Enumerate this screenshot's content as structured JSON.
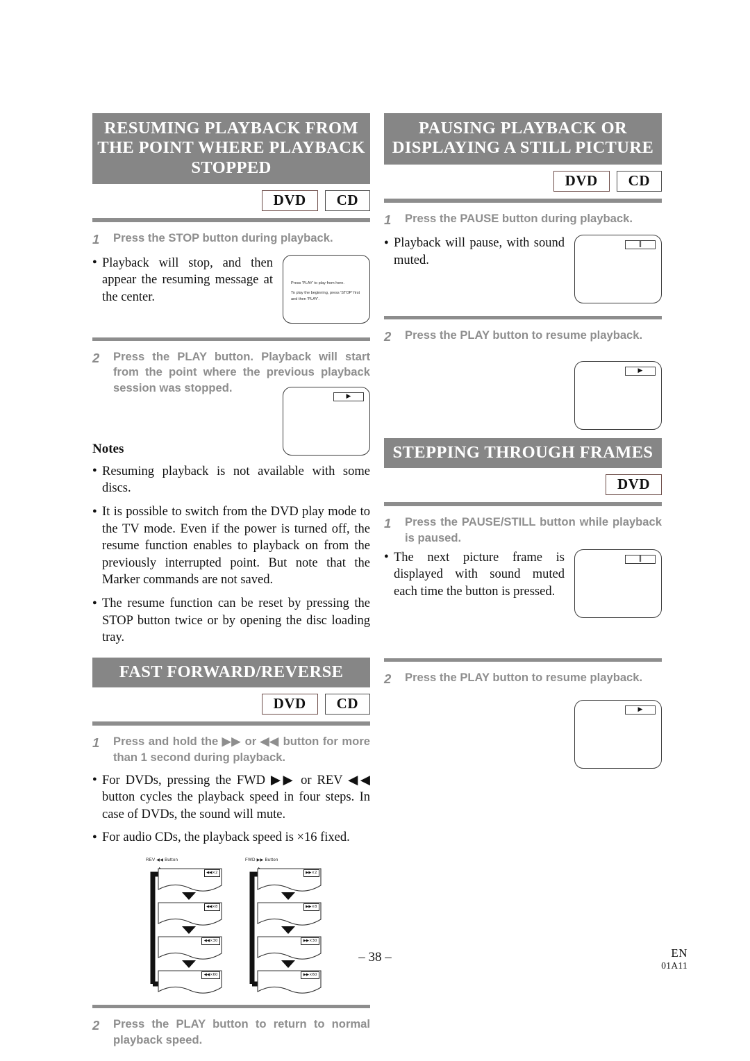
{
  "document": {
    "page_number": "– 38 –",
    "language_code": "EN",
    "doc_code": "01A11"
  },
  "left_column": {
    "section1": {
      "heading": "RESUMING PLAYBACK FROM THE POINT WHERE PLAYBACK STOPPED",
      "badges": [
        "DVD",
        "CD"
      ],
      "step1": {
        "number": "1",
        "text": "Press the STOP button during playback."
      },
      "step1_bullet": "Playback will stop, and then appear the resuming message at the center.",
      "screen1": {
        "msg_line1": "Press 'PLAY' to play from here.",
        "msg_line2": "To play the beginning, press 'STOP' first and then 'PLAY'."
      },
      "step2": {
        "number": "2",
        "text": "Press the PLAY button. Playback will start from the point where the previous playback session was stopped."
      },
      "screen2": {
        "osd": "▶"
      },
      "notes_title": "Notes",
      "notes": [
        "Resuming playback is not available with some discs.",
        "It is possible to switch from the DVD play mode to the TV mode. Even if the power is turned off, the resume function enables to playback on from the previously interrupted point. But note that the Marker commands are not saved.",
        "The resume function can be reset by pressing the STOP button twice or by opening the disc loading tray."
      ]
    },
    "section2": {
      "heading": "FAST FORWARD/REVERSE",
      "badges": [
        "DVD",
        "CD"
      ],
      "step1": {
        "number": "1",
        "text": "Press and hold the ▶▶ or ◀◀ button for more than 1 second during playback."
      },
      "bullets": [
        "For DVDs, pressing the FWD ▶▶ or REV ◀◀ button cycles the playback speed in four steps. In case of DVDs, the sound will mute.",
        "For audio CDs, the playback speed is ×16 fixed."
      ],
      "diagram": {
        "rev_label": "REV ◀◀ Button",
        "fwd_label": "FWD ▶▶ Button",
        "rev_speeds": [
          "◀◀×2",
          "◀◀×8",
          "◀◀×30",
          "◀◀×60"
        ],
        "fwd_speeds": [
          "▶▶×2",
          "▶▶×8",
          "▶▶×30",
          "▶▶×60"
        ]
      },
      "step2": {
        "number": "2",
        "text": "Press the PLAY button to return to normal playback speed."
      }
    }
  },
  "right_column": {
    "section1": {
      "heading": "PAUSING PLAYBACK OR DISPLAYING A STILL PICTURE",
      "badges": [
        "DVD",
        "CD"
      ],
      "step1": {
        "number": "1",
        "text": "Press the PAUSE button during playback."
      },
      "step1_bullet": "Playback will pause, with sound muted.",
      "screen1": {
        "osd": "‖"
      },
      "step2": {
        "number": "2",
        "text": "Press the PLAY button to resume playback."
      },
      "screen2": {
        "osd": "▶"
      }
    },
    "section2": {
      "heading": "STEPPING THROUGH FRAMES",
      "badges": [
        "DVD"
      ],
      "step1": {
        "number": "1",
        "text": "Press the PAUSE/STILL button while playback is paused."
      },
      "step1_bullet": "The next picture frame is displayed with sound muted each time the button is pressed.",
      "screen1": {
        "osd": "‖"
      },
      "step2": {
        "number": "2",
        "text": "Press the PLAY button to resume playback."
      },
      "screen2": {
        "osd": "▶"
      }
    }
  },
  "colors": {
    "heading_bar": "#868686",
    "rule": "#8d8d8d",
    "step_text": "#8e8e8e",
    "body_text": "#111111"
  }
}
